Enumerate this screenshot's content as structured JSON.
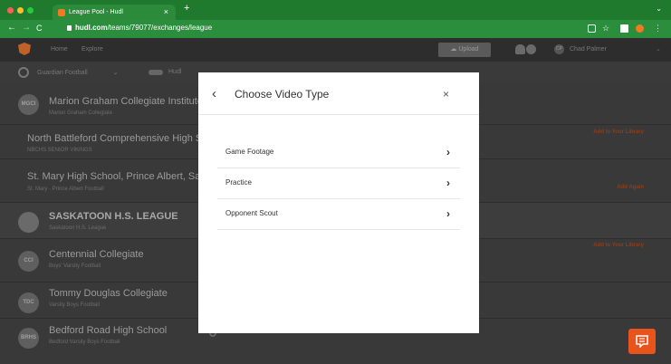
{
  "browser": {
    "tab_title": "League Pool - Hudl",
    "tab_close": "×",
    "new_tab": "+",
    "url_domain": "hudl.com",
    "url_path": "/teams/79077/exchanges/league"
  },
  "appbar": {
    "nav": [
      "Home",
      "Explore"
    ],
    "upload_label": "Upload",
    "user_initials": "CP",
    "user_name": "Chad Palmer"
  },
  "subbar": {
    "team": "Guardian Football",
    "second": "Hudl"
  },
  "rows": [
    {
      "badge": "MGCI",
      "name": "Marion Graham Collegiate Institute",
      "sub": "Marion Graham Collegiate",
      "action": ""
    },
    {
      "badge": "",
      "name": "North Battleford Comprehensive High School",
      "sub": "NBCHS SENIOR VIKINGS",
      "action": "Add to Your Library"
    },
    {
      "badge": "",
      "name": "St. Mary High School, Prince Albert, Sask",
      "sub": "St. Mary · Prince Albert Football",
      "action": "Add Again"
    },
    {
      "badge": "",
      "name": "SASKATOON H.S. LEAGUE",
      "sub": "Saskatoon H.S. League",
      "action": ""
    },
    {
      "badge": "CCI",
      "name": "Centennial Collegiate",
      "sub": "Boys' Varsity Football",
      "action": "Add to Your Library"
    },
    {
      "badge": "TDC",
      "name": "Tommy Douglas Collegiate",
      "sub": "Varsity Boys Football",
      "action": ""
    },
    {
      "badge": "BRHS",
      "name": "Bedford Road High School",
      "sub": "Bedford Varsity Boys Football",
      "action": ""
    }
  ],
  "modal": {
    "back": "‹",
    "title": "Choose Video Type",
    "close": "×",
    "options": [
      {
        "label": "Game Footage",
        "arrow": "›"
      },
      {
        "label": "Practice",
        "arrow": "›"
      },
      {
        "label": "Opponent Scout",
        "arrow": "›"
      }
    ]
  },
  "colors": {
    "browser_green": "#2a8e3d",
    "accent_orange": "#e8541c"
  }
}
